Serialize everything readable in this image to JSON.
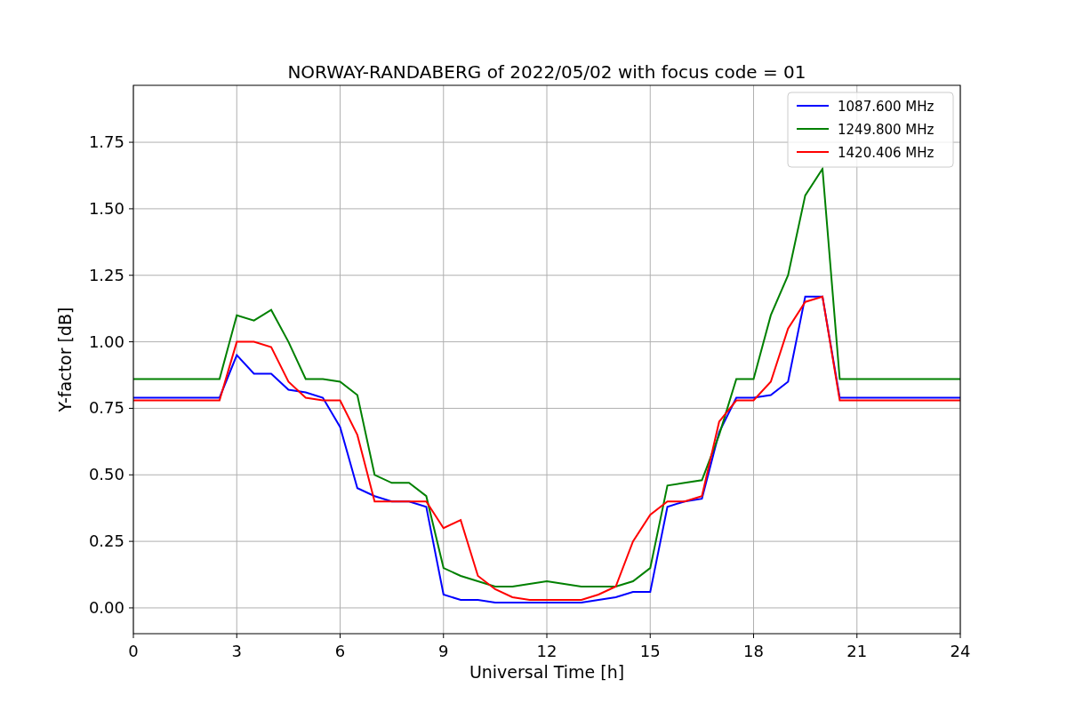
{
  "chart_data": {
    "type": "line",
    "title": "NORWAY-RANDABERG of 2022/05/02 with focus code = 01",
    "xlabel": "Universal Time [h]",
    "ylabel": "Y-factor [dB]",
    "x": [
      0,
      0.5,
      1,
      1.5,
      2,
      2.5,
      3,
      3.5,
      4,
      4.5,
      5,
      5.5,
      6,
      6.5,
      7,
      7.5,
      8,
      8.5,
      9,
      9.5,
      10,
      10.5,
      11,
      11.5,
      12,
      12.5,
      13,
      13.5,
      14,
      14.5,
      15,
      15.5,
      16,
      16.5,
      17,
      17.5,
      18,
      18.5,
      19,
      19.5,
      20,
      20.5,
      21,
      21.5,
      22,
      22.5,
      23,
      23.5,
      24
    ],
    "series": [
      {
        "name": "1087.600 MHz",
        "color": "#0000ff",
        "values": [
          0.79,
          0.79,
          0.79,
          0.79,
          0.79,
          0.79,
          0.95,
          0.88,
          0.88,
          0.82,
          0.81,
          0.79,
          0.68,
          0.45,
          0.42,
          0.4,
          0.4,
          0.38,
          0.05,
          0.03,
          0.03,
          0.02,
          0.02,
          0.02,
          0.02,
          0.02,
          0.02,
          0.03,
          0.04,
          0.06,
          0.06,
          0.38,
          0.4,
          0.41,
          0.66,
          0.79,
          0.79,
          0.8,
          0.85,
          1.17,
          1.17,
          0.79,
          0.79,
          0.79,
          0.79,
          0.79,
          0.79,
          0.79,
          0.79
        ]
      },
      {
        "name": "1249.800 MHz",
        "color": "#008000",
        "values": [
          0.86,
          0.86,
          0.86,
          0.86,
          0.86,
          0.86,
          1.1,
          1.08,
          1.12,
          1.0,
          0.86,
          0.86,
          0.85,
          0.8,
          0.5,
          0.47,
          0.47,
          0.42,
          0.15,
          0.12,
          0.1,
          0.08,
          0.08,
          0.09,
          0.1,
          0.09,
          0.08,
          0.08,
          0.08,
          0.1,
          0.15,
          0.46,
          0.47,
          0.48,
          0.65,
          0.86,
          0.86,
          1.1,
          1.25,
          1.55,
          1.65,
          0.86,
          0.86,
          0.86,
          0.86,
          0.86,
          0.86,
          0.86,
          0.86
        ]
      },
      {
        "name": "1420.406 MHz",
        "color": "#ff0000",
        "values": [
          0.78,
          0.78,
          0.78,
          0.78,
          0.78,
          0.78,
          1.0,
          1.0,
          0.98,
          0.85,
          0.79,
          0.78,
          0.78,
          0.65,
          0.4,
          0.4,
          0.4,
          0.4,
          0.3,
          0.33,
          0.12,
          0.07,
          0.04,
          0.03,
          0.03,
          0.03,
          0.03,
          0.05,
          0.08,
          0.25,
          0.35,
          0.4,
          0.4,
          0.42,
          0.7,
          0.78,
          0.78,
          0.85,
          1.05,
          1.15,
          1.17,
          0.78,
          0.78,
          0.78,
          0.78,
          0.78,
          0.78,
          0.78,
          0.78
        ]
      }
    ],
    "grid": true,
    "legend": true,
    "xlim": [
      0,
      24
    ],
    "ylim": [
      -0.097,
      1.964
    ],
    "xticks": [
      0,
      3,
      6,
      9,
      12,
      15,
      18,
      21,
      24
    ],
    "yticks": [
      {
        "value": 0,
        "label": "0.00"
      },
      {
        "value": 0.25,
        "label": "0.25"
      },
      {
        "value": 0.5,
        "label": "0.50"
      },
      {
        "value": 0.75,
        "label": "0.75"
      },
      {
        "value": 1,
        "label": "1.00"
      },
      {
        "value": 1.25,
        "label": "1.25"
      },
      {
        "value": 1.5,
        "label": "1.50"
      },
      {
        "value": 1.75,
        "label": "1.75"
      }
    ]
  }
}
